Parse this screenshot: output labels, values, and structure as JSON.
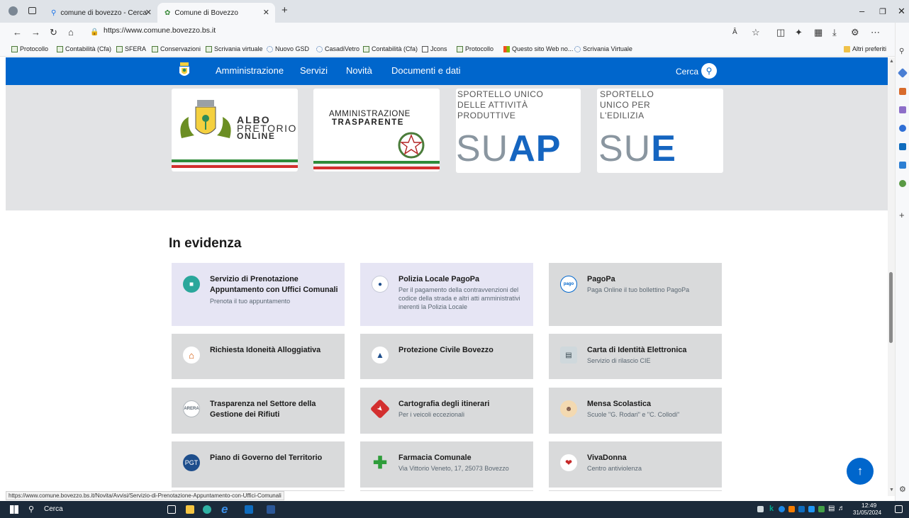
{
  "browser": {
    "tabs": [
      {
        "label": "comune di bovezzo - Cerca"
      },
      {
        "label": "Comune di Bovezzo"
      }
    ],
    "new_tab": "+",
    "address": "https://www.comune.bovezzo.bs.it",
    "favorites": [
      "Protocollo",
      "Contabilità (Cfa)",
      "SFERA",
      "Conservazioni",
      "Scrivania virtuale",
      "Nuovo GSD",
      "CasadiVetro",
      "Contabilità (Cfa)",
      "Jcons",
      "Protocollo",
      "Questo sito Web no...",
      "Scrivania Virtuale"
    ],
    "other_favorites": "Altri preferiti",
    "status_url": "https://www.comune.bovezzo.bs.it/Novita/Avvisi/Servizio-di-Prenotazione-Appuntamento-con-Uffici-Comunali"
  },
  "site": {
    "nav": [
      "Amministrazione",
      "Servizi",
      "Novità",
      "Documenti e dati"
    ],
    "search_label": "Cerca",
    "brand_color": "#0066cc",
    "banners": {
      "albo": {
        "line1": "ALBO",
        "line2": "PRETORIO",
        "line3": "ONLINE"
      },
      "trasparente": {
        "line1": "AMMINISTRAZIONE",
        "line2": "TRASPARENTE"
      },
      "suap": {
        "line1": "SPORTELLO UNICO",
        "line2": "DELLE ATTIVITÀ",
        "line3": "PRODUTTIVE",
        "big_a": "SU",
        "big_b": "AP"
      },
      "sue": {
        "line1": "SPORTELLO",
        "line2": "UNICO PER",
        "line3": "L'EDILIZIA",
        "big_a": "SU",
        "big_b": "E"
      }
    },
    "section_title": "In evidenza",
    "cards": [
      {
        "title": "Servizio di Prenotazione Appuntamento con Uffici Comunali",
        "sub": "Prenota il tuo appuntamento",
        "icon": "calendar-icon"
      },
      {
        "title": "Polizia Locale PagoPa",
        "sub": "Per il pagamento della contravvenzioni del codice della strada e altri atti amministrativi inerenti la Polizia Locale",
        "icon": "police-icon"
      },
      {
        "title": "PagoPa",
        "sub": "Paga Online il tuo bollettino PagoPa",
        "icon": "pagopa-icon"
      },
      {
        "title": "Richiesta Idoneità Alloggiativa",
        "sub": "",
        "icon": "house-icon"
      },
      {
        "title": "Protezione Civile Bovezzo",
        "sub": "",
        "icon": "civil-protection-icon"
      },
      {
        "title": "Carta di Identità Elettronica",
        "sub": "Servizio di rilascio CIE",
        "icon": "id-card-icon"
      },
      {
        "title": "Trasparenza nel Settore della Gestione dei Rifiuti",
        "sub": "",
        "icon": "arera-icon",
        "icon_text": "ARERA"
      },
      {
        "title": "Cartografia degli itinerari",
        "sub": "Per i veicoli eccezionali",
        "icon": "map-sign-icon"
      },
      {
        "title": "Mensa Scolastica",
        "sub": "Scuole \"G. Rodari\" e \"C. Collodi\"",
        "icon": "chef-icon"
      },
      {
        "title": "Piano di Governo del Territorio",
        "sub": "",
        "icon": "pgt-icon",
        "icon_text": "PGT"
      },
      {
        "title": "Farmacia Comunale",
        "sub": "Via Vittorio Veneto, 17, 25073 Bovezzo",
        "icon": "pharmacy-cross-icon"
      },
      {
        "title": "VivaDonna",
        "sub": "Centro antiviolenza",
        "icon": "heart-icon"
      }
    ]
  },
  "taskbar": {
    "search": "Cerca",
    "time": "12:49",
    "date": "31/05/2024"
  }
}
